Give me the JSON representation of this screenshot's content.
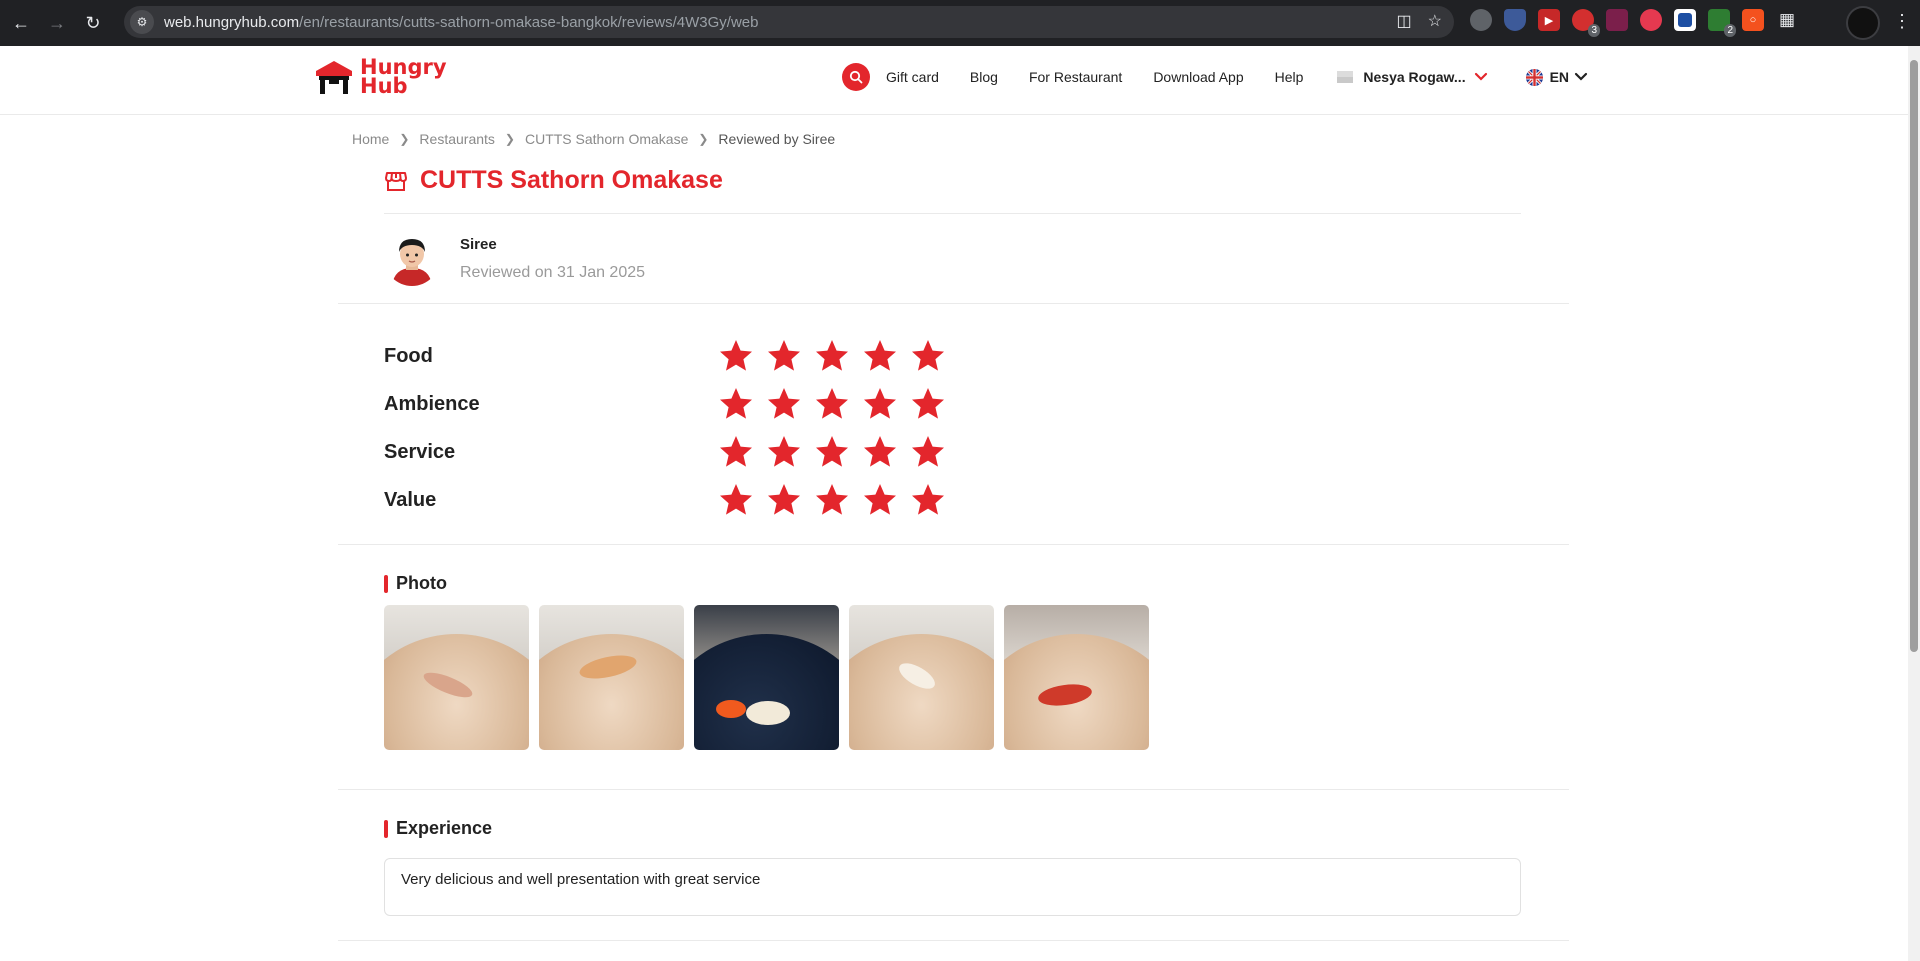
{
  "browser": {
    "url_host": "web.hungryhub.com",
    "url_path": "/en/restaurants/cutts-sathorn-omakase-bangkok/reviews/4W3Gy/web",
    "ext_badges": [
      "3",
      "2"
    ]
  },
  "header": {
    "logo_line1": "Hungry",
    "logo_line2": "Hub",
    "nav": [
      "Gift card",
      "Blog",
      "For Restaurant",
      "Download App",
      "Help"
    ],
    "user_name": "Nesya Rogaw...",
    "language": "EN",
    "brand_color": "#e3262c"
  },
  "breadcrumb": [
    "Home",
    "Restaurants",
    "CUTTS Sathorn Omakase",
    "Reviewed by Siree"
  ],
  "restaurant": {
    "name": "CUTTS Sathorn Omakase"
  },
  "reviewer": {
    "name": "Siree",
    "date": "Reviewed on 31 Jan 2025"
  },
  "ratings": [
    {
      "label": "Food",
      "stars": 5,
      "max": 5
    },
    {
      "label": "Ambience",
      "stars": 5,
      "max": 5
    },
    {
      "label": "Service",
      "stars": 5,
      "max": 5
    },
    {
      "label": "Value",
      "stars": 5,
      "max": 5
    }
  ],
  "photo_section": {
    "title": "Photo",
    "count": 5
  },
  "experience": {
    "title": "Experience",
    "text": "Very delicious and well presentation with great service"
  }
}
